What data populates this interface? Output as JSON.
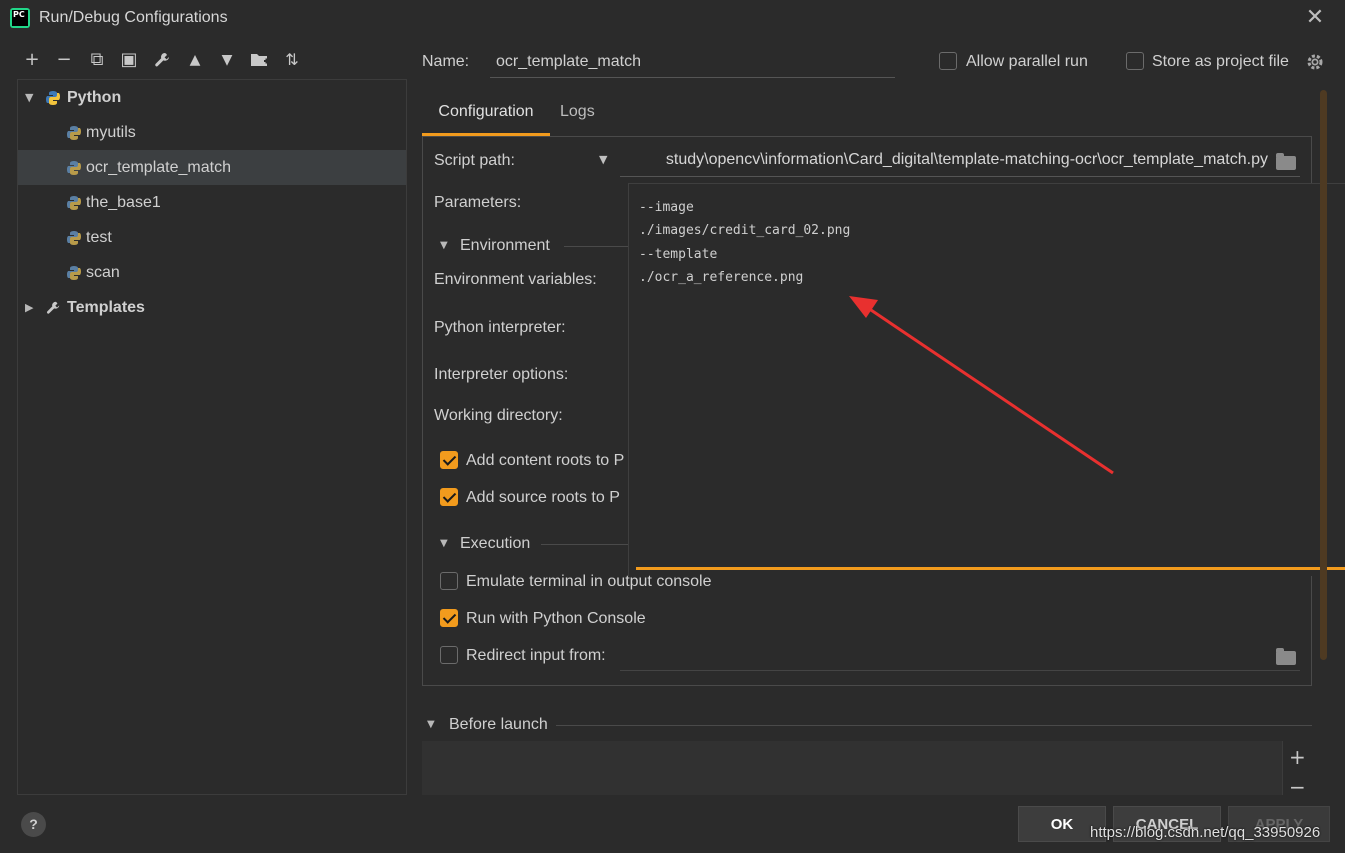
{
  "window": {
    "title": "Run/Debug Configurations",
    "logo_text": "PC"
  },
  "toolbar": {
    "buttons": [
      {
        "icon": "plus-icon",
        "glyph": "+"
      },
      {
        "icon": "minus-icon",
        "glyph": "−"
      },
      {
        "icon": "copy-icon",
        "glyph": "⧉"
      },
      {
        "icon": "save-icon",
        "glyph": "▣"
      },
      {
        "icon": "wrench-icon",
        "glyph": "🔧"
      },
      {
        "icon": "arrow-up-icon",
        "glyph": "▲"
      },
      {
        "icon": "arrow-down-icon",
        "glyph": "▼"
      },
      {
        "icon": "new-folder-icon",
        "glyph": "▰"
      },
      {
        "icon": "sort-icon",
        "glyph": "⇅"
      }
    ]
  },
  "tree": {
    "python_group": "Python",
    "items": [
      {
        "label": "myutils"
      },
      {
        "label": "ocr_template_match"
      },
      {
        "label": "the_base1"
      },
      {
        "label": "test"
      },
      {
        "label": "scan"
      }
    ],
    "templates_label": "Templates"
  },
  "config": {
    "name_label": "Name:",
    "name_value": "ocr_template_match",
    "allow_parallel_label": "Allow parallel run",
    "allow_parallel": false,
    "store_project_label": "Store as project file",
    "store_project": false,
    "tabs": [
      "Configuration",
      "Logs"
    ],
    "script_path_label": "Script path:",
    "script_path_value": "study\\opencv\\information\\Card_digital\\template-matching-ocr\\ocr_template_match.py",
    "parameters_label": "Parameters:",
    "environment_header": "Environment",
    "env_vars_label": "Environment variables:",
    "python_interpreter_label": "Python interpreter:",
    "interpreter_options_label": "Interpreter options:",
    "working_dir_label": "Working directory:",
    "add_content_roots_label": "Add content roots to P",
    "add_content_roots": true,
    "add_source_roots_label": "Add source roots to P",
    "add_source_roots": true,
    "execution_header": "Execution",
    "emulate_terminal_label": "Emulate terminal in output console",
    "emulate_terminal": false,
    "run_python_console_label": "Run with Python Console",
    "run_python_console": true,
    "redirect_input_label": "Redirect input from:",
    "redirect_input": false
  },
  "parameters_popup": {
    "lines": [
      "--image",
      "./images/credit_card_02.png",
      "--template",
      "./ocr_a_reference.png"
    ]
  },
  "before_launch": {
    "header": "Before launch",
    "add_glyph": "+",
    "remove_glyph": "−"
  },
  "buttons": {
    "ok": "OK",
    "cancel": "CANCEL",
    "apply": "APPLY",
    "help": "?"
  },
  "watermark": "https://blog.csdn.net/qq_33950926",
  "colors": {
    "accent": "#f29b1d",
    "background": "#2b2b2b",
    "arrow": "#e8302f"
  }
}
